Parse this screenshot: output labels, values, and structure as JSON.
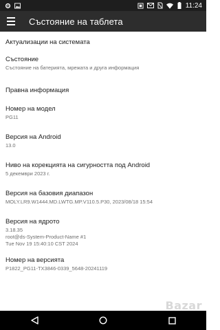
{
  "status_bar": {
    "time": "11:24",
    "icons_left": [
      "gear-icon",
      "image-icon"
    ],
    "icons_right": [
      "screenshot-icon",
      "mail-icon",
      "no-sim-icon",
      "wifi-icon",
      "battery-icon"
    ]
  },
  "toolbar": {
    "title": "Състояние на таблета",
    "menu_icon": "hamburger-menu-icon"
  },
  "items": [
    {
      "title": "Актуализации на системата",
      "subtitle": ""
    },
    {
      "title": "Състояние",
      "subtitle": "Състояние на батерията, мрежата и друга информация"
    },
    {
      "title": "Правна информация",
      "subtitle": ""
    },
    {
      "title": "Номер на модел",
      "subtitle": "PG11"
    },
    {
      "title": "Версия на Android",
      "subtitle": "13.0"
    },
    {
      "title": "Ниво на корекцията на сигурността под Android",
      "subtitle": "5 декември 2023 г."
    },
    {
      "title": "Версия на базовия диапазон",
      "subtitle": "MOLY.LR9.W1444.MD.LWTG.MP.V110.5.P30, 2023/08/18 15:54"
    },
    {
      "title": "Версия на ядрото",
      "subtitle_lines": [
        "3.18.35",
        "root@ds-System-Product-Name #1",
        "Tue Nov 19 15:40:10 CST 2024"
      ]
    },
    {
      "title": "Номер на версията",
      "subtitle": "P1822_PG11-TX3846-0339_5648-20241119"
    }
  ],
  "nav_bar": {
    "back_icon": "back-triangle-icon",
    "home_icon": "home-circle-icon",
    "recents_icon": "recents-square-icon"
  },
  "watermark": "Bazar"
}
